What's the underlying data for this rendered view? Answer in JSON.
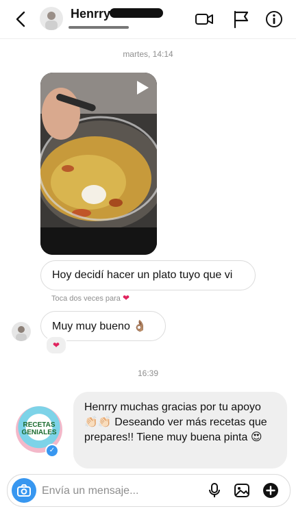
{
  "header": {
    "name": "Henrry",
    "icons": [
      "back-arrow-icon",
      "video-call-icon",
      "flag-icon",
      "info-icon"
    ]
  },
  "thread": {
    "timestamp_1": "martes, 14:14",
    "sent_text_1": "Hoy decidí hacer un plato tuyo que vi",
    "hint_text": "Toca dos veces para",
    "received_text_1": "Muy muy bueno 👌🏽",
    "reaction": "❤",
    "timestamp_2": "16:39",
    "brand_logo_text": "RECETAS GENIALES",
    "reply_text": "Henrry muchas gracias por tu apoyo 👏🏻👏🏻 Deseando ver más recetas que prepares!! Tiene muy buena pinta 😍"
  },
  "composer": {
    "placeholder": "Envía un mensaje...",
    "icons": [
      "camera-icon",
      "microphone-icon",
      "gallery-icon",
      "add-icon"
    ]
  },
  "colors": {
    "accent": "#3897f0",
    "bubble_border": "#dbdbdb",
    "incoming_bubble": "#efefef",
    "muted_text": "#8e8e8e"
  }
}
